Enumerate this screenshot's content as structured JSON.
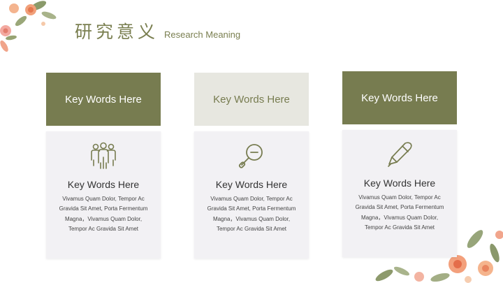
{
  "title": {
    "chinese": "研究意义",
    "english": "Research Meaning"
  },
  "colors": {
    "accent": "#777c50",
    "accent_light": "#e7e7e0",
    "card_bg": "#f2f1f4"
  },
  "cards": [
    {
      "header": "Key Words Here",
      "icon": "people-group-icon",
      "title": "Key Words Here",
      "text": "Vivamus Quam Dolor, Tempor Ac Gravida Sit Amet, Porta Fermentum Magna，Vivamus Quam Dolor, Tempor Ac Gravida Sit Amet"
    },
    {
      "header": "Key Words Here",
      "icon": "magnifier-icon",
      "title": "Key Words Here",
      "text": "Vivamus Quam Dolor, Tempor Ac Gravida Sit Amet, Porta Fermentum Magna，Vivamus Quam Dolor, Tempor Ac Gravida Sit Amet"
    },
    {
      "header": "Key Words Here",
      "icon": "pen-icon",
      "title": "Key Words Here",
      "text": "Vivamus Quam Dolor, Tempor Ac Gravida Sit Amet, Porta Fermentum Magna，Vivamus Quam Dolor, Tempor Ac Gravida Sit Amet"
    }
  ]
}
